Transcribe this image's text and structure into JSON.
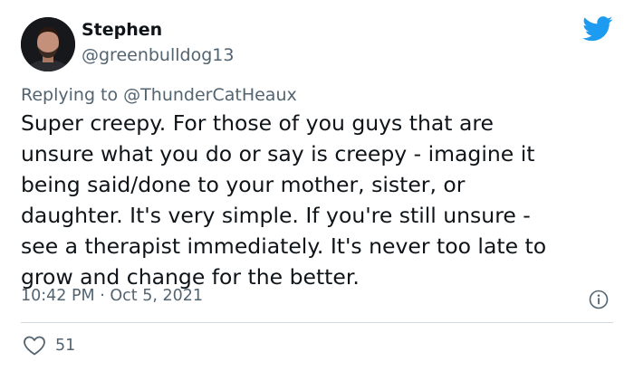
{
  "author": {
    "name": "Stephen",
    "handle": "@greenbulldog13"
  },
  "reply": {
    "prefix": "Replying to",
    "mention": "@ThunderCatHeaux"
  },
  "tweet": {
    "text": "Super creepy.  For those of you guys that are\nunsure what you do or say is creepy - imagine it\nbeing said/done to your mother, sister, or\ndaughter.  It's very simple.  If you're still unsure -\nsee a therapist immediately.  It's never too late to\ngrow and change  for the better.",
    "time": "10:42 PM",
    "separator": "·",
    "date": "Oct 5, 2021"
  },
  "actions": {
    "like_count": "51"
  },
  "icons": {
    "brand": "twitter-bird-icon",
    "info": "info-icon",
    "like": "heart-icon"
  },
  "colors": {
    "brand_blue": "#1d9bf0",
    "secondary_text": "#536471",
    "divider": "#cfd9de"
  }
}
